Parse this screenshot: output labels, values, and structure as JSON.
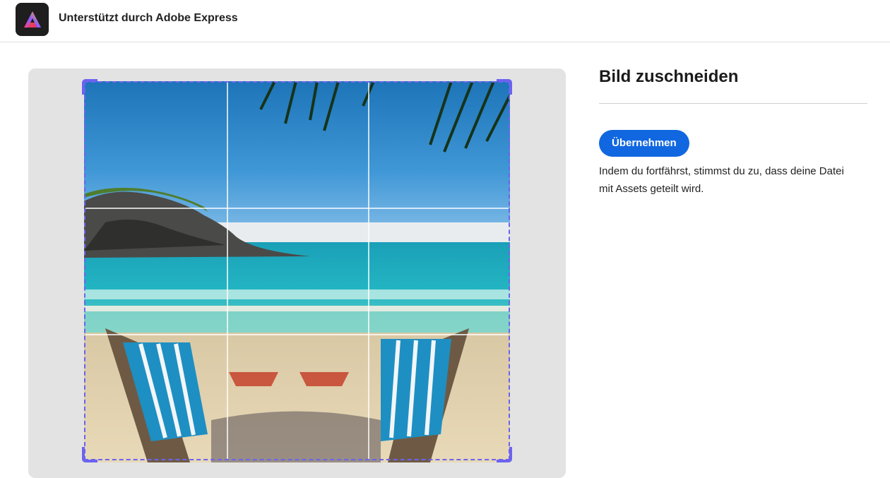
{
  "header": {
    "title": "Unterstützt durch Adobe Express",
    "logo_icon": "adobe-express-logo-icon"
  },
  "editor": {
    "image_description_icon": "beach-photo",
    "crop_grid": "rule-of-thirds"
  },
  "panel": {
    "title": "Bild zuschneiden",
    "apply_label": "Übernehmen",
    "consent_text": "Indem du fortfährst, stimmst du zu, dass deine Datei mit Assets geteilt wird."
  },
  "colors": {
    "accent": "#1167e0",
    "crop_frame": "#6b63f0",
    "canvas_bg": "#e3e3e3"
  }
}
